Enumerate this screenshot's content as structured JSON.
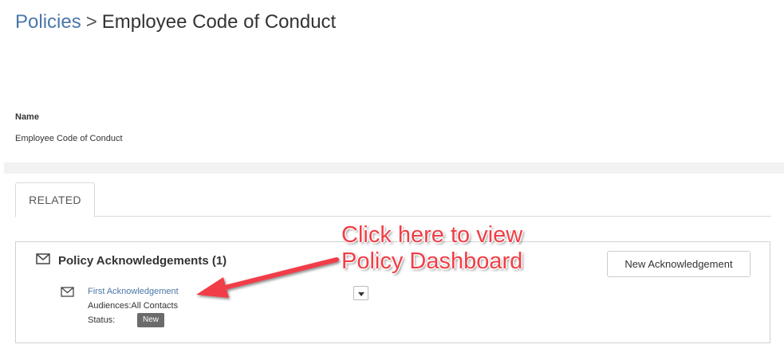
{
  "breadcrumb": {
    "parent": "Policies",
    "separator": ">",
    "current": "Employee Code of Conduct"
  },
  "details": {
    "name_label": "Name",
    "name_value": "Employee Code of Conduct"
  },
  "tabs": [
    {
      "label": "RELATED",
      "active": true
    }
  ],
  "related_panel": {
    "title": "Policy Acknowledgements (1)",
    "new_button_label": "New Acknowledgement",
    "items": [
      {
        "link": "First Acknowledgement",
        "audience": "Audiences:All Contacts",
        "status_label": "Status:",
        "status_badge": "New"
      }
    ]
  },
  "annotation": {
    "line1": "Click here to view",
    "line2": "Policy Dashboard",
    "color": "#f03e46"
  },
  "colors": {
    "link": "#4a77a8",
    "badge": "#6b6b6b",
    "band": "#f2f2f2"
  },
  "icons": [
    "envelope-icon",
    "caret-down-icon"
  ]
}
